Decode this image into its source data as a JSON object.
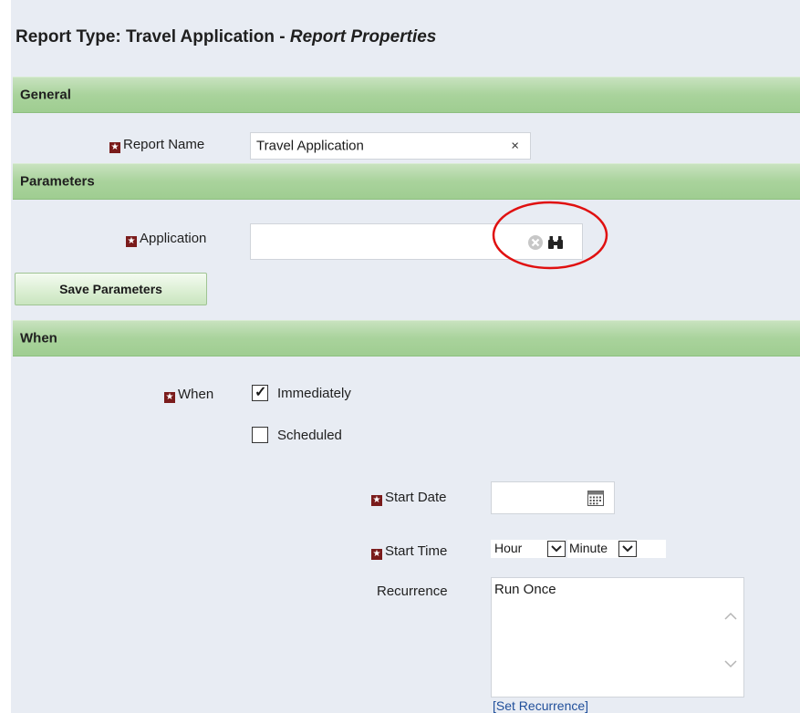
{
  "header": {
    "title_prefix": "Report Type: Travel Application - ",
    "title_suffix": "Report Properties"
  },
  "sections": {
    "general": "General",
    "parameters": "Parameters",
    "when": "When"
  },
  "general": {
    "report_name_label": "Report Name",
    "report_name_value": "Travel Application",
    "clear_glyph": "×"
  },
  "parameters": {
    "application_label": "Application",
    "application_value": "",
    "save_button": "Save Parameters"
  },
  "when": {
    "when_label": "When",
    "immediately_label": "Immediately",
    "immediately_checked": true,
    "scheduled_label": "Scheduled",
    "scheduled_checked": false,
    "start_date_label": "Start Date",
    "start_date_value": "",
    "start_time_label": "Start Time",
    "hour_value": "Hour",
    "minute_value": "Minute",
    "recurrence_label": "Recurrence",
    "recurrence_value": "Run Once",
    "set_recurrence_link": "[Set Recurrence]"
  },
  "required_marker": "★",
  "colors": {
    "section_green": "#a9d39c",
    "required_red": "#7a1b1b",
    "annotation_circle": "#e01010",
    "link_blue": "#1f4e9a"
  }
}
